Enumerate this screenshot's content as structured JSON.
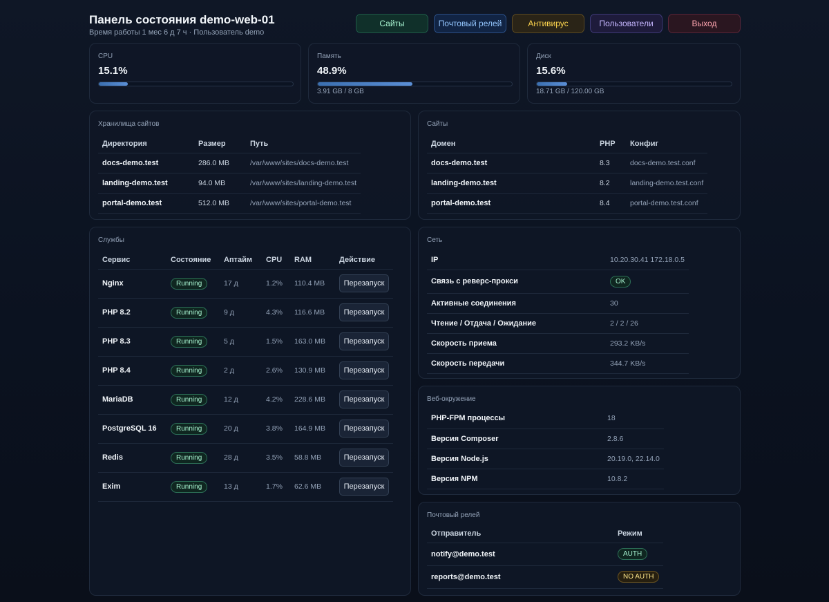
{
  "header": {
    "title": "Панель состояния demo-web-01",
    "subtitle": "Время работы 1 мес 6 д 7 ч · Пользователь demo"
  },
  "nav": {
    "sites": "Сайты",
    "relay": "Почтовый релей",
    "antivirus": "Антивирус",
    "users": "Пользователи",
    "logout": "Выход"
  },
  "metrics": {
    "cpu": {
      "label": "CPU",
      "value": "15.1%",
      "percent": 15.1
    },
    "memory": {
      "label": "Память",
      "value": "48.9%",
      "percent": 48.9,
      "detail": "3.91 GB / 8 GB"
    },
    "disk": {
      "label": "Диск",
      "value": "15.6%",
      "percent": 15.6,
      "detail": "18.71 GB / 120.00 GB"
    }
  },
  "storage": {
    "label": "Хранилища сайтов",
    "headers": [
      "Директория",
      "Размер",
      "Путь"
    ],
    "rows": [
      [
        "docs-demo.test",
        "286.0 MB",
        "/var/www/sites/docs-demo.test"
      ],
      [
        "landing-demo.test",
        "94.0 MB",
        "/var/www/sites/landing-demo.test"
      ],
      [
        "portal-demo.test",
        "512.0 MB",
        "/var/www/sites/portal-demo.test"
      ]
    ]
  },
  "sites": {
    "label": "Сайты",
    "headers": [
      "Домен",
      "PHP",
      "Конфиг"
    ],
    "rows": [
      [
        "docs-demo.test",
        "8.3",
        "docs-demo.test.conf"
      ],
      [
        "landing-demo.test",
        "8.2",
        "landing-demo.test.conf"
      ],
      [
        "portal-demo.test",
        "8.4",
        "portal-demo.test.conf"
      ]
    ]
  },
  "services": {
    "label": "Службы",
    "headers": [
      "Сервис",
      "Состояние",
      "Аптайм",
      "CPU",
      "RAM",
      "Действие"
    ],
    "action_label": "Перезапуск",
    "rows": [
      [
        "Nginx",
        "Running",
        "17 д",
        "1.2%",
        "110.4 MB"
      ],
      [
        "PHP 8.2",
        "Running",
        "9 д",
        "4.3%",
        "116.6 MB"
      ],
      [
        "PHP 8.3",
        "Running",
        "5 д",
        "1.5%",
        "163.0 MB"
      ],
      [
        "PHP 8.4",
        "Running",
        "2 д",
        "2.6%",
        "130.9 MB"
      ],
      [
        "MariaDB",
        "Running",
        "12 д",
        "4.2%",
        "228.6 MB"
      ],
      [
        "PostgreSQL 16",
        "Running",
        "20 д",
        "3.8%",
        "164.9 MB"
      ],
      [
        "Redis",
        "Running",
        "28 д",
        "3.5%",
        "58.8 MB"
      ],
      [
        "Exim",
        "Running",
        "13 д",
        "1.7%",
        "62.6 MB"
      ]
    ]
  },
  "network": {
    "label": "Сеть",
    "rows": [
      [
        "IP",
        "10.20.30.41 172.18.0.5"
      ],
      [
        "Связь с реверс-прокси",
        "OK"
      ],
      [
        "Активные соединения",
        "30"
      ],
      [
        "Чтение / Отдача / Ожидание",
        "2 / 2 / 26"
      ],
      [
        "Скорость приема",
        "293.2 KB/s"
      ],
      [
        "Скорость передачи",
        "344.7 KB/s"
      ]
    ]
  },
  "webenv": {
    "label": "Веб-окружение",
    "rows": [
      [
        "PHP-FPM процессы",
        "18"
      ],
      [
        "Версия Composer",
        "2.8.6"
      ],
      [
        "Версия Node.js",
        "20.19.0, 22.14.0"
      ],
      [
        "Версия NPM",
        "10.8.2"
      ]
    ]
  },
  "mailrelay": {
    "label": "Почтовый релей",
    "headers": [
      "Отправитель",
      "Режим"
    ],
    "rows": [
      [
        "notify@demo.test",
        "AUTH"
      ],
      [
        "reports@demo.test",
        "NO AUTH"
      ]
    ]
  }
}
